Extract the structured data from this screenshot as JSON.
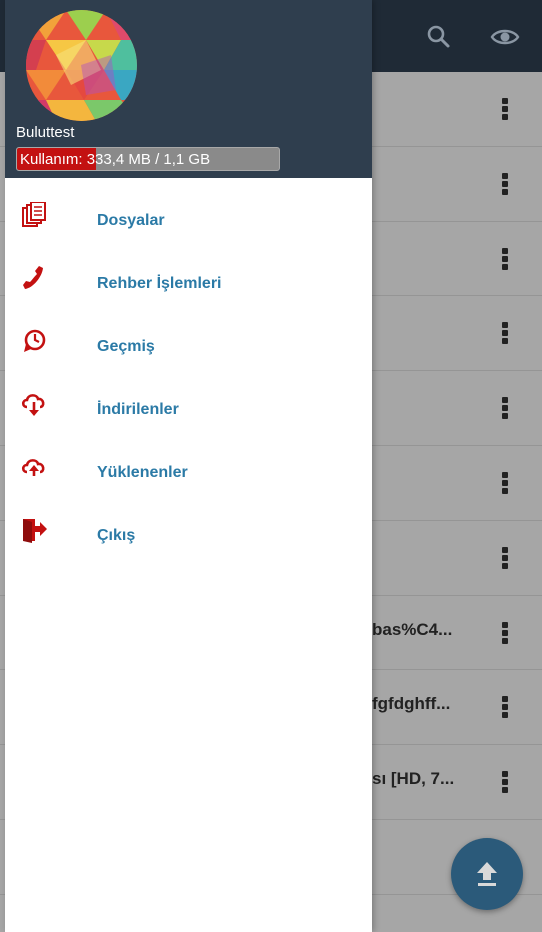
{
  "colors": {
    "accent": "#2b7aa6",
    "icon_red": "#c31111",
    "header_bg": "#2f3e4e"
  },
  "drawer": {
    "user_name": "Buluttest",
    "usage": {
      "label": "Kullanım",
      "text": ": 333,4 MB /  1,1 GB",
      "fraction": 0.3
    },
    "items": [
      {
        "label": "Dosyalar",
        "icon": "files-icon"
      },
      {
        "label": "Rehber İşlemleri",
        "icon": "phone-icon"
      },
      {
        "label": "Geçmiş",
        "icon": "history-icon"
      },
      {
        "label": "İndirilenler",
        "icon": "cloud-download-icon"
      },
      {
        "label": "Yüklenenler",
        "icon": "cloud-upload-icon"
      },
      {
        "label": "Çıkış",
        "icon": "exit-icon"
      }
    ]
  },
  "background_list": {
    "rows": [
      {
        "title": ""
      },
      {
        "title": ""
      },
      {
        "title": ""
      },
      {
        "title": ""
      },
      {
        "title": ""
      },
      {
        "title": ""
      },
      {
        "title": ""
      },
      {
        "title": "bas%C4..."
      },
      {
        "title": "fgfdghff..."
      },
      {
        "title": "sı [HD, 7..."
      },
      {
        "title": ""
      }
    ]
  }
}
